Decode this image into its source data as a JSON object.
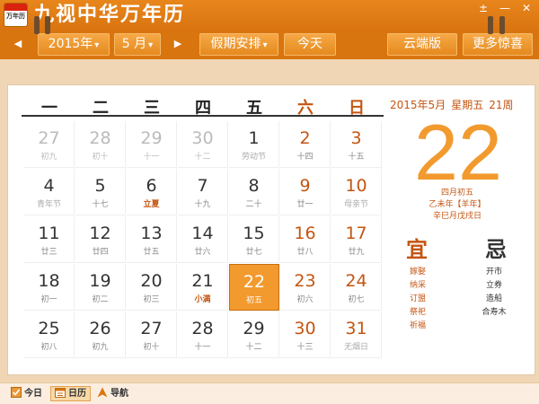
{
  "app": {
    "icon_text": "万年历",
    "title": "九视中华万年历",
    "window": {
      "pin": "±",
      "minimize": "—",
      "close": "✕"
    }
  },
  "toolbar": {
    "prev": "◀",
    "next": "▶",
    "year": "2015年",
    "month": "5 月",
    "holiday": "假期安排",
    "today": "今天",
    "cloud": "云端版",
    "more": "更多惊喜",
    "caret": "▾"
  },
  "weekdays": [
    "一",
    "二",
    "三",
    "四",
    "五",
    "六",
    "日"
  ],
  "calendar": {
    "rows": [
      [
        {
          "d": "27",
          "l": "初九",
          "other": true
        },
        {
          "d": "28",
          "l": "初十",
          "other": true
        },
        {
          "d": "29",
          "l": "十一",
          "other": true
        },
        {
          "d": "30",
          "l": "十二",
          "other": true
        },
        {
          "d": "1",
          "l": "劳动节",
          "holiday": true
        },
        {
          "d": "2",
          "l": "十四"
        },
        {
          "d": "3",
          "l": "十五"
        }
      ],
      [
        {
          "d": "4",
          "l": "青年节",
          "holiday": true
        },
        {
          "d": "5",
          "l": "十七"
        },
        {
          "d": "6",
          "l": "立夏",
          "term": true
        },
        {
          "d": "7",
          "l": "十九"
        },
        {
          "d": "8",
          "l": "二十"
        },
        {
          "d": "9",
          "l": "廿一"
        },
        {
          "d": "10",
          "l": "母亲节",
          "holiday": true
        }
      ],
      [
        {
          "d": "11",
          "l": "廿三"
        },
        {
          "d": "12",
          "l": "廿四"
        },
        {
          "d": "13",
          "l": "廿五"
        },
        {
          "d": "14",
          "l": "廿六"
        },
        {
          "d": "15",
          "l": "廿七"
        },
        {
          "d": "16",
          "l": "廿八"
        },
        {
          "d": "17",
          "l": "廿九"
        }
      ],
      [
        {
          "d": "18",
          "l": "初一"
        },
        {
          "d": "19",
          "l": "初二"
        },
        {
          "d": "20",
          "l": "初三"
        },
        {
          "d": "21",
          "l": "小满",
          "term": true
        },
        {
          "d": "22",
          "l": "初五",
          "today": true
        },
        {
          "d": "23",
          "l": "初六"
        },
        {
          "d": "24",
          "l": "初七"
        }
      ],
      [
        {
          "d": "25",
          "l": "初八"
        },
        {
          "d": "26",
          "l": "初九"
        },
        {
          "d": "27",
          "l": "初十"
        },
        {
          "d": "28",
          "l": "十一"
        },
        {
          "d": "29",
          "l": "十二"
        },
        {
          "d": "30",
          "l": "十三"
        },
        {
          "d": "31",
          "l": "无烟日",
          "holiday": true
        }
      ]
    ]
  },
  "detail": {
    "year_month": "2015年5月",
    "weekday": "星期五",
    "week_no": "21周",
    "day": "22",
    "lunar_date": "四月初五",
    "ganzhi_year": "乙未年【羊年】",
    "ganzhi_day": "辛巳月戊戌日",
    "yi_label": "宜",
    "ji_label": "忌",
    "yi_items": [
      "嫁娶",
      "纳采",
      "订盟",
      "祭祀",
      "祈福"
    ],
    "ji_items": [
      "开市",
      "立券",
      "造船",
      "合寿木"
    ]
  },
  "statusbar": {
    "today": "今日",
    "calendar": "日历",
    "nav": "导航"
  },
  "colors": {
    "accent": "#d9750e",
    "highlight": "#f29a2e",
    "weekend": "#c45512"
  }
}
